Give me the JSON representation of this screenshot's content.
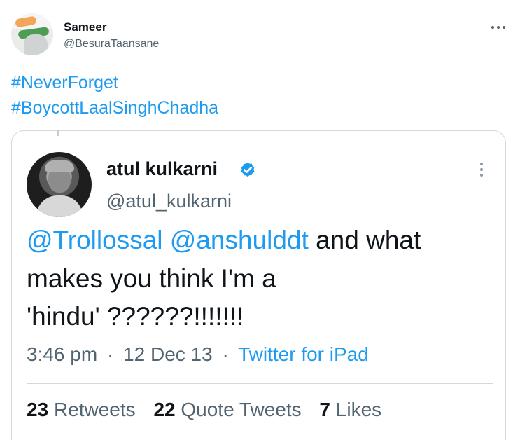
{
  "tweet": {
    "author": {
      "name": "Sameer",
      "handle": "@BesuraTaansane",
      "avatar_icon": "avatar-photo"
    },
    "more_icon": "more-horizontal-icon",
    "hashtags": [
      "#NeverForget",
      "#BoycottLaalSinghChadha"
    ]
  },
  "quoted": {
    "author": {
      "name": "atul kulkarni",
      "handle": "@atul_kulkarni",
      "verified_icon": "verified-badge-icon"
    },
    "text": {
      "line1_mention1": "@Trollossal",
      "line1_mention2": "@anshulddt",
      "line1_rest": " and what",
      "line2": "makes you think I'm a",
      "line3": "'hindu' ??????!!!!!!!"
    },
    "meta": {
      "time": "3:46 pm",
      "date": "12 Dec 13",
      "source": "Twitter for iPad",
      "separator": "·"
    },
    "stats": {
      "retweets_count": "23",
      "retweets_label": "Retweets",
      "quotes_count": "22",
      "quotes_label": "Quote Tweets",
      "likes_count": "7",
      "likes_label": "Likes"
    }
  },
  "colors": {
    "link": "#1d9bf0",
    "secondary_text": "#536471",
    "primary_text": "#0f1419",
    "border": "#cfd9de"
  }
}
